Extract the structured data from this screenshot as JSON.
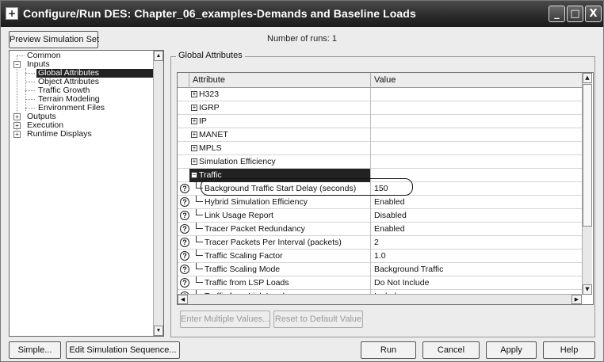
{
  "window": {
    "title": "Configure/Run DES: Chapter_06_examples-Demands and Baseline Loads",
    "minimize_label": "_",
    "maximize_label": "□",
    "close_label": "X"
  },
  "toolbar": {
    "preview_label": "Preview Simulation Set",
    "runs_label": "Number of runs: 1"
  },
  "tree": {
    "items": [
      {
        "label": "Common",
        "expander": ""
      },
      {
        "label": "Inputs",
        "expander": "−"
      },
      {
        "label": "Global Attributes",
        "expander": "",
        "selected": true
      },
      {
        "label": "Object Attributes",
        "expander": ""
      },
      {
        "label": "Traffic Growth",
        "expander": ""
      },
      {
        "label": "Terrain Modeling",
        "expander": ""
      },
      {
        "label": "Environment Files",
        "expander": ""
      },
      {
        "label": "Outputs",
        "expander": "+"
      },
      {
        "label": "Execution",
        "expander": "+"
      },
      {
        "label": "Runtime Displays",
        "expander": "+"
      }
    ]
  },
  "group": {
    "legend": "Global Attributes"
  },
  "grid": {
    "col_attribute": "Attribute",
    "col_value": "Value",
    "groups": [
      {
        "label": "H323",
        "value": ""
      },
      {
        "label": "IGRP",
        "value": ""
      },
      {
        "label": "IP",
        "value": ""
      },
      {
        "label": "MANET",
        "value": ""
      },
      {
        "label": "MPLS",
        "value": ""
      },
      {
        "label": "Simulation Efficiency",
        "value": ""
      },
      {
        "label": "Traffic",
        "value": ""
      }
    ],
    "rows": [
      {
        "label": "Background Traffic Start Delay (seconds)",
        "value": "150"
      },
      {
        "label": "Hybrid Simulation Efficiency",
        "value": "Enabled"
      },
      {
        "label": "Link Usage Report",
        "value": "Disabled"
      },
      {
        "label": "Tracer Packet Redundancy",
        "value": "Enabled"
      },
      {
        "label": "Tracer Packets Per Interval (packets)",
        "value": "2"
      },
      {
        "label": "Traffic Scaling Factor",
        "value": "1.0"
      },
      {
        "label": "Traffic Scaling Mode",
        "value": "Background Traffic"
      },
      {
        "label": "Traffic from LSP Loads",
        "value": "Do Not Include"
      },
      {
        "label": "Traffic from Link Loads",
        "value": "Include"
      }
    ]
  },
  "actions": {
    "enter_multiple": "Enter Multiple Values...",
    "reset_default": "Reset to Default Value"
  },
  "footer": {
    "simple": "Simple...",
    "edit_sequence": "Edit Simulation Sequence...",
    "run": "Run",
    "cancel": "Cancel",
    "apply": "Apply",
    "help": "Help"
  },
  "icons": {
    "help_glyph": "?",
    "app_glyph": "+"
  }
}
